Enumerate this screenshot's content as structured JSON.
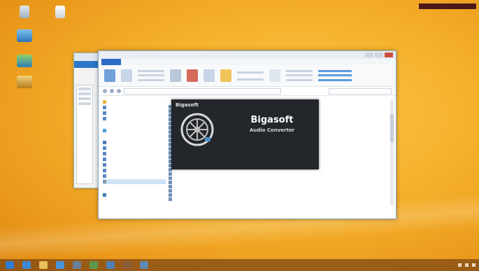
{
  "splash": {
    "brand_small": "Bigasoft",
    "brand": "Bigasoft",
    "product": "Audio Converter"
  }
}
